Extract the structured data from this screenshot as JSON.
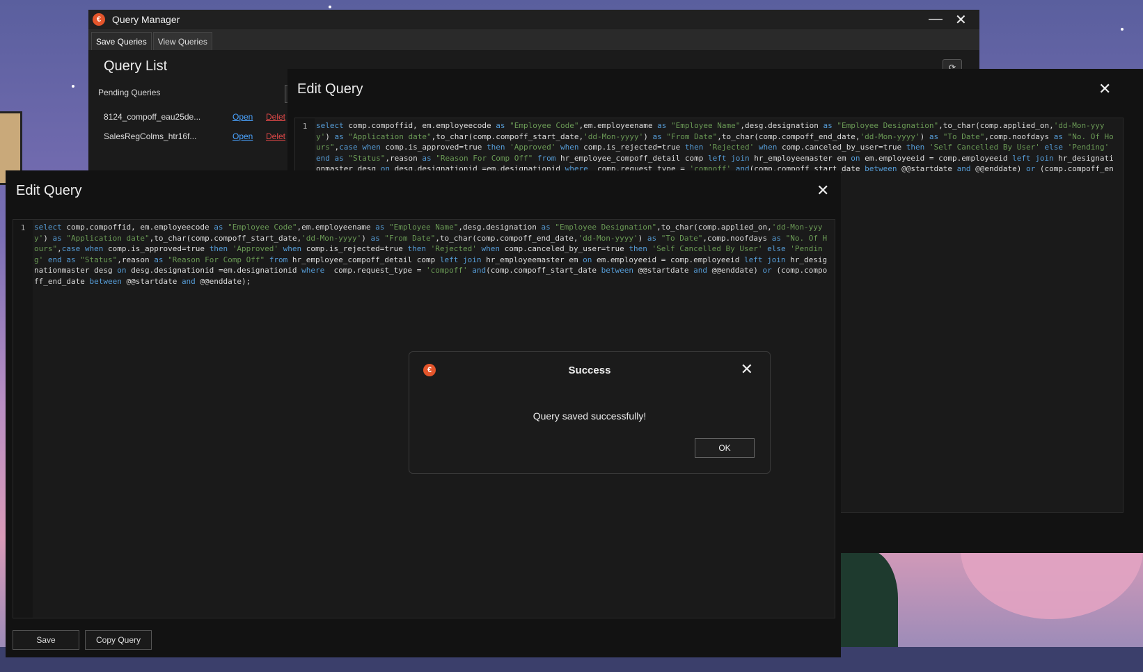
{
  "colors": {
    "accent": "#e4552b",
    "keyword": "#569cd6",
    "string": "#6a9955",
    "link": "#4aa3ff",
    "danger": "#e04848"
  },
  "main_window": {
    "title": "Query Manager",
    "minimize_icon": "minimize-icon",
    "close_glyph": "✕",
    "minimize_glyph": "—",
    "tabs": [
      {
        "label": "Save Queries"
      },
      {
        "label": "View Queries"
      }
    ],
    "heading": "Query List",
    "pending_label": "Pending Queries",
    "queries": [
      {
        "name": "8124_compoff_eau25de...",
        "open": "Open",
        "delete": "Delet"
      },
      {
        "name": "SalesRegColms_htr16f...",
        "open": "Open",
        "delete": "Delet"
      }
    ]
  },
  "edit_back": {
    "title": "Edit Query",
    "close_glyph": "✕",
    "line_no": "1"
  },
  "edit_front": {
    "title": "Edit Query",
    "close_glyph": "✕",
    "line_no": "1",
    "save_label": "Save",
    "copy_label": "Copy Query"
  },
  "code_tokens": [
    [
      "kw",
      "select"
    ],
    [
      "t",
      " comp.compoffid, em.employeecode "
    ],
    [
      "kw",
      "as"
    ],
    [
      "t",
      " "
    ],
    [
      "str",
      "\"Employee Code\""
    ],
    [
      "t",
      ",em.employeename "
    ],
    [
      "kw",
      "as"
    ],
    [
      "t",
      " "
    ],
    [
      "str",
      "\"Employee Name\""
    ],
    [
      "t",
      ",desg.designation "
    ],
    [
      "kw",
      "as"
    ],
    [
      "t",
      " "
    ],
    [
      "str",
      "\"Employee Designation\""
    ],
    [
      "t",
      ",to_char(comp.applied_on,"
    ],
    [
      "str",
      "'dd-Mon-yyyy'"
    ],
    [
      "t",
      ") "
    ],
    [
      "kw",
      "as"
    ],
    [
      "t",
      " "
    ],
    [
      "str",
      "\"Application date\""
    ],
    [
      "t",
      ",to_char(comp.compoff_start_date,"
    ],
    [
      "str",
      "'dd-Mon-yyyy'"
    ],
    [
      "t",
      ") "
    ],
    [
      "kw",
      "as"
    ],
    [
      "t",
      " "
    ],
    [
      "str",
      "\"From Date\""
    ],
    [
      "t",
      ",to_char(comp.compoff_end_date,"
    ],
    [
      "str",
      "'dd-Mon-yyyy'"
    ],
    [
      "t",
      ") "
    ],
    [
      "kw",
      "as"
    ],
    [
      "t",
      " "
    ],
    [
      "str",
      "\"To Date\""
    ],
    [
      "t",
      ",comp.noofdays "
    ],
    [
      "kw",
      "as"
    ],
    [
      "t",
      " "
    ],
    [
      "str",
      "\"No. Of Hours\""
    ],
    [
      "t",
      ","
    ],
    [
      "kw",
      "case when"
    ],
    [
      "t",
      " comp.is_approved=true "
    ],
    [
      "kw",
      "then"
    ],
    [
      "t",
      " "
    ],
    [
      "str",
      "'Approved'"
    ],
    [
      "t",
      " "
    ],
    [
      "kw",
      "when"
    ],
    [
      "t",
      " comp.is_rejected=true "
    ],
    [
      "kw",
      "then"
    ],
    [
      "t",
      " "
    ],
    [
      "str",
      "'Rejected'"
    ],
    [
      "t",
      " "
    ],
    [
      "kw",
      "when"
    ],
    [
      "t",
      " comp.canceled_by_user=true "
    ],
    [
      "kw",
      "then"
    ],
    [
      "t",
      " "
    ],
    [
      "str",
      "'Self Cancelled By User'"
    ],
    [
      "t",
      " "
    ],
    [
      "kw",
      "else"
    ],
    [
      "t",
      " "
    ],
    [
      "str",
      "'Pending'"
    ],
    [
      "t",
      " "
    ],
    [
      "kw",
      "end"
    ],
    [
      "t",
      " "
    ],
    [
      "kw",
      "as"
    ],
    [
      "t",
      " "
    ],
    [
      "str",
      "\"Status\""
    ],
    [
      "t",
      ",reason "
    ],
    [
      "kw",
      "as"
    ],
    [
      "t",
      " "
    ],
    [
      "str",
      "\"Reason For Comp Off\""
    ],
    [
      "t",
      " "
    ],
    [
      "kw",
      "from"
    ],
    [
      "t",
      " hr_employee_compoff_detail comp "
    ],
    [
      "kw",
      "left join"
    ],
    [
      "t",
      " hr_employeemaster em "
    ],
    [
      "kw",
      "on"
    ],
    [
      "t",
      " em.employeeid = comp.employeeid "
    ],
    [
      "kw",
      "left join"
    ],
    [
      "t",
      " hr_designationmaster desg "
    ],
    [
      "kw",
      "on"
    ],
    [
      "t",
      " desg.designationid =em.designationid "
    ],
    [
      "kw",
      "where"
    ],
    [
      "t",
      "  comp.request_type = "
    ],
    [
      "str",
      "'compoff'"
    ],
    [
      "t",
      " "
    ],
    [
      "kw",
      "and"
    ],
    [
      "t",
      "(comp.compoff_start_date "
    ],
    [
      "kw",
      "between"
    ],
    [
      "t",
      " @@startdate "
    ],
    [
      "kw",
      "and"
    ],
    [
      "t",
      " @@enddate) "
    ],
    [
      "kw",
      "or"
    ],
    [
      "t",
      " (comp.compoff_end_date "
    ],
    [
      "kw",
      "between"
    ],
    [
      "t",
      " @@startdate "
    ],
    [
      "kw",
      "and"
    ],
    [
      "t",
      " @@enddate);"
    ]
  ],
  "dialog": {
    "title": "Success",
    "message": "Query saved successfully!",
    "ok_label": "OK",
    "close_glyph": "✕",
    "icon_glyph": "€"
  }
}
